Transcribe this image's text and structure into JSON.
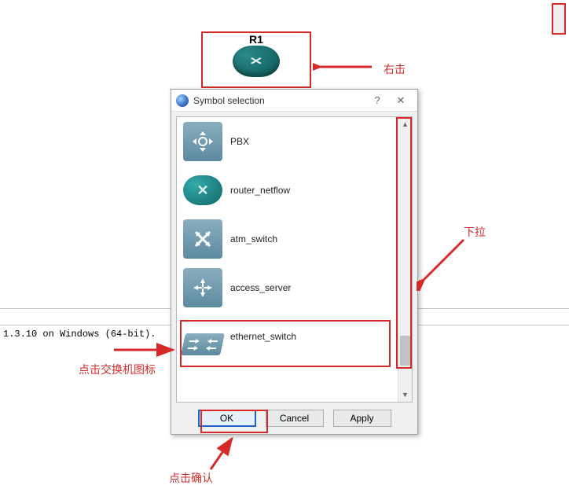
{
  "status_line": "1.3.10 on Windows (64-bit).",
  "r1": {
    "label": "R1"
  },
  "dialog": {
    "title": "Symbol selection",
    "items": [
      {
        "label": "PBX",
        "icon": "pbx-icon"
      },
      {
        "label": "router_netflow",
        "icon": "router-netflow-icon"
      },
      {
        "label": "atm_switch",
        "icon": "atm-switch-icon"
      },
      {
        "label": "access_server",
        "icon": "access-server-icon"
      },
      {
        "label": "ethernet_switch",
        "icon": "ethernet-switch-icon"
      }
    ],
    "buttons": {
      "ok": "OK",
      "cancel": "Cancel",
      "apply": "Apply"
    }
  },
  "annotations": {
    "right_click": "右击",
    "pull_down": "下拉",
    "click_switch_icon": "点击交换机图标",
    "click_confirm": "点击确认"
  },
  "colors": {
    "highlight": "#d62a2a"
  }
}
